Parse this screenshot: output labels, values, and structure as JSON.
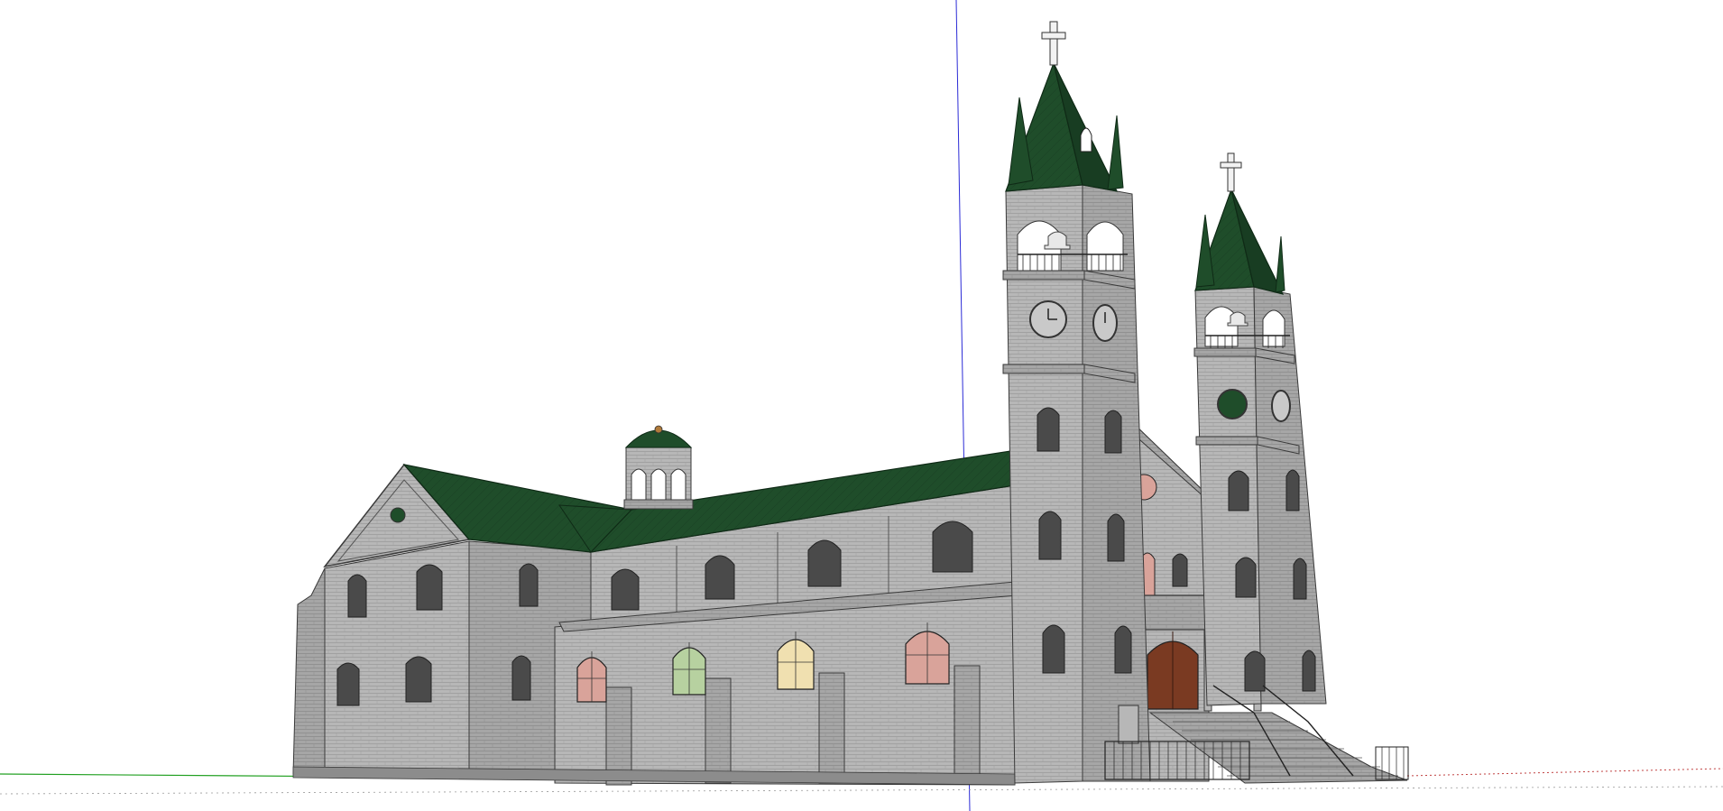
{
  "viewport": {
    "background": "#ffffff"
  },
  "axes": {
    "vertical_color": "#2b2bd6",
    "green_color": "#22a022",
    "red_dotted_color": "#c04040"
  },
  "model": {
    "subject": "church",
    "roof_color": "#1f4d2a",
    "roof_edge_color": "#0f2a16",
    "stone_color": "#b7b7b7",
    "stone_shade_color": "#9a9a9a",
    "stone_dark_color": "#7c7c7c",
    "outline_color": "#3a3a3a",
    "window_dark_color": "#4a4a4a",
    "stained_glass_colors": [
      "#d9a39a",
      "#b7d1a0",
      "#f0e0b0"
    ],
    "door_color": "#7a3a22",
    "cross_color": "#f2f2f2"
  }
}
